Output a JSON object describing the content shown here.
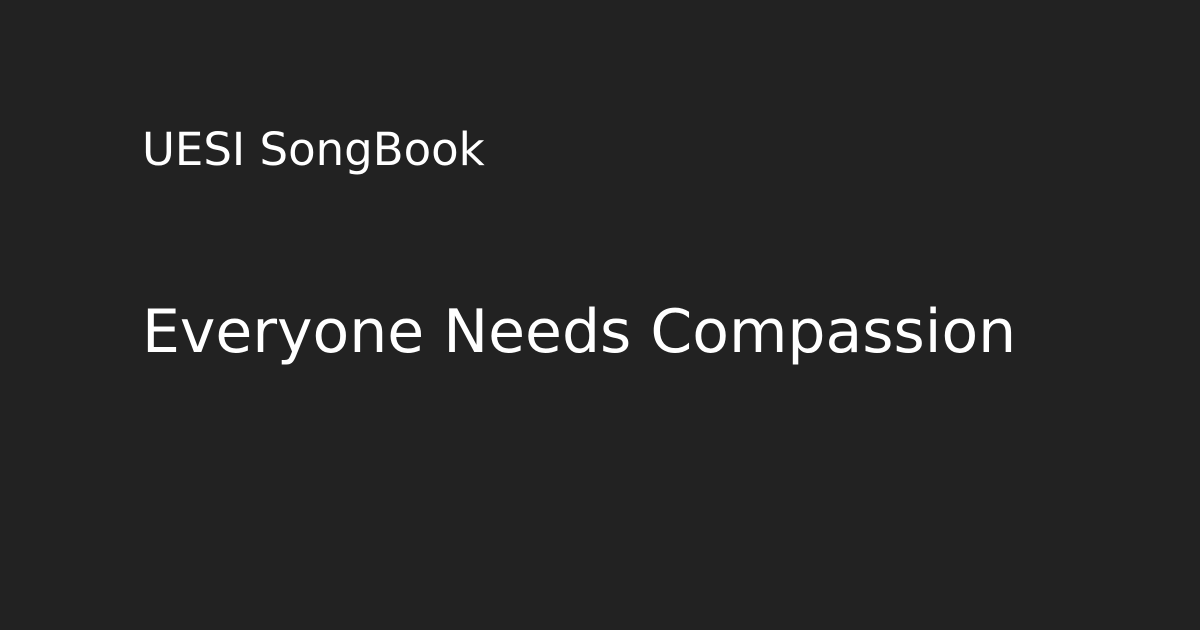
{
  "site": {
    "name": "UESI SongBook"
  },
  "song": {
    "title": "Everyone Needs Compassion"
  },
  "colors": {
    "background": "#222222",
    "text": "#ffffff"
  }
}
